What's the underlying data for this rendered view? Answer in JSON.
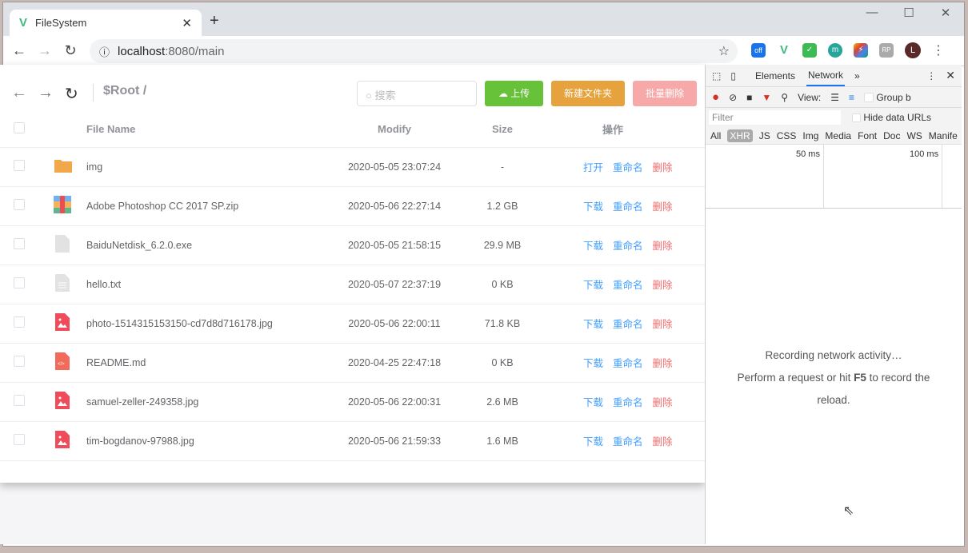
{
  "browser": {
    "tab_title": "FileSystem",
    "url_host": "localhost",
    "url_path": ":8080/main",
    "ext_off_badge": "off",
    "ext_rp": "RP",
    "ext_m": "m",
    "avatar_letter": "L"
  },
  "toolbar": {
    "breadcrumb": "$Root /",
    "search_placeholder": "搜索",
    "upload": "上传",
    "new_folder": "新建文件夹",
    "batch_delete": "批量删除"
  },
  "colors": {
    "upload": "#67c23a",
    "new_folder": "#e6a23c",
    "batch_delete": "#f7a9a9",
    "link": "#409eff",
    "danger": "#f56c6c"
  },
  "table": {
    "headers": {
      "name": "File Name",
      "modify": "Modify",
      "size": "Size",
      "actions": "操作"
    },
    "rows": [
      {
        "icon": "folder",
        "name": "img",
        "modify": "2020-05-05 23:07:24",
        "size": "-",
        "primary": "打开"
      },
      {
        "icon": "zip",
        "name": "Adobe Photoshop CC 2017 SP.zip",
        "modify": "2020-05-06 22:27:14",
        "size": "1.2 GB",
        "primary": "下载"
      },
      {
        "icon": "file",
        "name": "BaiduNetdisk_6.2.0.exe",
        "modify": "2020-05-05 21:58:15",
        "size": "29.9 MB",
        "primary": "下载"
      },
      {
        "icon": "text",
        "name": "hello.txt",
        "modify": "2020-05-07 22:37:19",
        "size": "0 KB",
        "primary": "下载"
      },
      {
        "icon": "image",
        "name": "photo-1514315153150-cd7d8d716178.jpg",
        "modify": "2020-05-06 22:00:11",
        "size": "71.8 KB",
        "primary": "下载"
      },
      {
        "icon": "code",
        "name": "README.md",
        "modify": "2020-04-25 22:47:18",
        "size": "0 KB",
        "primary": "下载"
      },
      {
        "icon": "image",
        "name": "samuel-zeller-249358.jpg",
        "modify": "2020-05-06 22:00:31",
        "size": "2.6 MB",
        "primary": "下载"
      },
      {
        "icon": "image",
        "name": "tim-bogdanov-97988.jpg",
        "modify": "2020-05-06 21:59:33",
        "size": "1.6 MB",
        "primary": "下载"
      }
    ],
    "rename": "重命名",
    "delete": "删除"
  },
  "devtools": {
    "tabs": [
      "Elements",
      "Network"
    ],
    "view_label": "View:",
    "group_label": "Group b",
    "filter_placeholder": "Filter",
    "hide_data_urls": "Hide data URLs",
    "filters": [
      "All",
      "XHR",
      "JS",
      "CSS",
      "Img",
      "Media",
      "Font",
      "Doc",
      "WS",
      "Manife"
    ],
    "ticks": [
      "50 ms",
      "100 ms"
    ],
    "msg1": "Recording network activity…",
    "msg2_pre": "Perform a request or hit ",
    "msg2_key": "F5",
    "msg2_post": " to record the",
    "msg3": "reload."
  }
}
